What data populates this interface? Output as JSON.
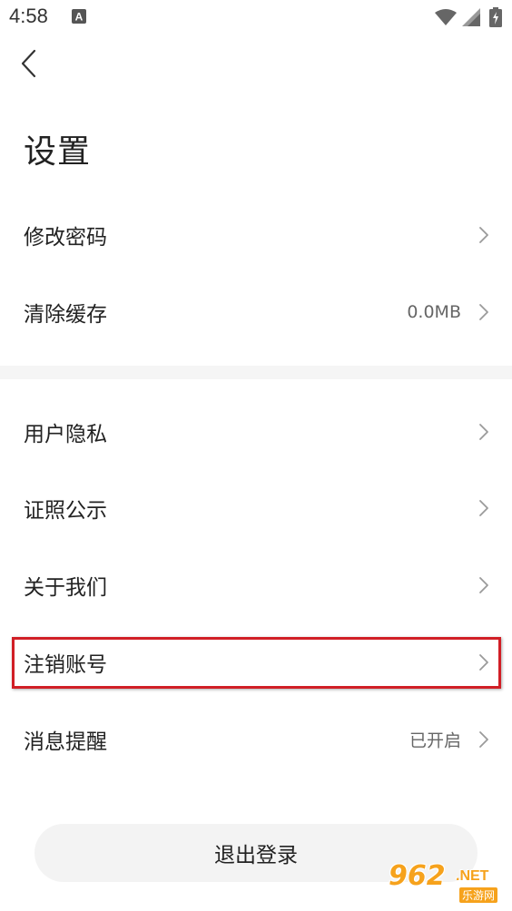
{
  "status_bar": {
    "time": "4:58",
    "notification_icon": "A",
    "icons": [
      "wifi-icon",
      "signal-icon",
      "battery-charging-icon"
    ]
  },
  "header": {
    "back_icon": "chevron-left-icon",
    "title": "设置"
  },
  "settings": {
    "change_password": {
      "label": "修改密码"
    },
    "clear_cache": {
      "label": "清除缓存",
      "value": "0.0MB"
    },
    "user_privacy": {
      "label": "用户隐私"
    },
    "license_disclosure": {
      "label": "证照公示"
    },
    "about_us": {
      "label": "关于我们"
    },
    "delete_account": {
      "label": "注销账号"
    },
    "message_reminder": {
      "label": "消息提醒",
      "value": "已开启"
    }
  },
  "logout": {
    "label": "退出登录"
  },
  "watermark": {
    "number": "962",
    "suffix": ".NET",
    "cn": "乐游网"
  },
  "colors": {
    "highlight_border": "#d11f26",
    "divider_band": "#f5f5f5",
    "button_bg": "#f3f3f3",
    "watermark": "#f6a21c"
  }
}
